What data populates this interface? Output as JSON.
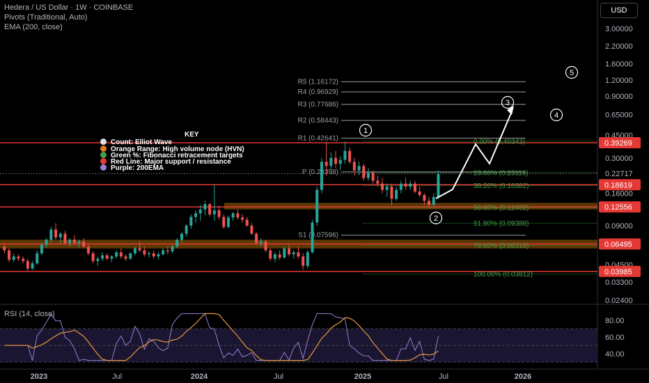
{
  "header": {
    "symbol": "Hedera / US Dollar · 1W · COINBASE",
    "indicator1": "Pivots (Traditional, Auto)",
    "indicator2": "EMA (200, close)"
  },
  "currency_button": "USD",
  "key": {
    "title": "KEY",
    "items": [
      {
        "label": "Count: Elliot Wave",
        "color": "#e0e0e0"
      },
      {
        "label": "Orange Range: High volume node (HVN)",
        "color": "#e07a1f"
      },
      {
        "label": "Green %: Fibonacci retracement targets",
        "color": "#43a047"
      },
      {
        "label": "Red Line: Major support / resistance",
        "color": "#e53935"
      },
      {
        "label": "Purple: 200EMA",
        "color": "#9c7fd4"
      }
    ]
  },
  "rsi_label": "RSI (14, close)",
  "colors": {
    "up": "#26a69a",
    "down": "#ef5350",
    "red_line": "#e53935",
    "hvn": "#7a4a06",
    "fib": "#43a047",
    "pivot": "#9e9e9e",
    "ema": "#9c7fd4",
    "rsi": "#9c7fd4",
    "rsi_ma": "#e89a3c"
  },
  "chart_data": {
    "type": "candlestick",
    "y_scale": "log",
    "price_axis_ticks": [
      "3.00000",
      "2.20000",
      "1.60000",
      "1.20000",
      "0.90000",
      "0.65000",
      "0.45000",
      "0.30000",
      "0.22717",
      "0.16000",
      "0.09000",
      "0.04500",
      "0.03300",
      "0.02400"
    ],
    "price_tags": [
      {
        "value": "0.39269",
        "color": "#e53935"
      },
      {
        "value": "0.18619",
        "color": "#e53935"
      },
      {
        "value": "0.12556",
        "color": "#e53935"
      },
      {
        "value": "0.06495",
        "color": "#e53935"
      },
      {
        "value": "0.03985",
        "color": "#e53935"
      }
    ],
    "current_price": "0.22717",
    "x_axis_labels": [
      "2023",
      "Jul",
      "2024",
      "Jul",
      "2025",
      "Jul",
      "2026"
    ],
    "red_lines": [
      0.39269,
      0.18619,
      0.12556,
      0.06495,
      0.03985
    ],
    "hvn_zones": [
      {
        "low": 0.06,
        "high": 0.07
      },
      {
        "low": 0.12,
        "high": 0.135
      }
    ],
    "pivots": [
      {
        "label": "R5 (1.16172)",
        "value": 1.16172
      },
      {
        "label": "R4 (0.96929)",
        "value": 0.96929
      },
      {
        "label": "R3 (0.77686)",
        "value": 0.77686
      },
      {
        "label": "R2 (0.58443)",
        "value": 0.58443
      },
      {
        "label": "R1 (0.42641)",
        "value": 0.42641
      },
      {
        "label": "P (0.23398)",
        "value": 0.23398
      },
      {
        "label": "S1 (0.07596)",
        "value": 0.07596
      }
    ],
    "fibonacci": [
      {
        "label": "0.00% (0.40343)",
        "value": 0.40343
      },
      {
        "label": "23.60% (0.23119)",
        "value": 0.23119
      },
      {
        "label": "38.20% (0.18382)",
        "value": 0.18382
      },
      {
        "label": "50.00% (0.12402)",
        "value": 0.12402
      },
      {
        "label": "61.80% (0.09388)",
        "value": 0.09388
      },
      {
        "label": "78.60% (0.06316)",
        "value": 0.06316
      },
      {
        "label": "100.00% (0.03812)",
        "value": 0.03812
      }
    ],
    "wave_labels": [
      "1",
      "2",
      "3",
      "4",
      "5"
    ],
    "candles": [
      {
        "o": 0.062,
        "h": 0.066,
        "l": 0.055,
        "c": 0.058
      },
      {
        "o": 0.058,
        "h": 0.06,
        "l": 0.047,
        "c": 0.049
      },
      {
        "o": 0.049,
        "h": 0.055,
        "l": 0.047,
        "c": 0.052
      },
      {
        "o": 0.052,
        "h": 0.054,
        "l": 0.048,
        "c": 0.05
      },
      {
        "o": 0.05,
        "h": 0.052,
        "l": 0.046,
        "c": 0.048
      },
      {
        "o": 0.048,
        "h": 0.05,
        "l": 0.04,
        "c": 0.042
      },
      {
        "o": 0.042,
        "h": 0.048,
        "l": 0.041,
        "c": 0.046
      },
      {
        "o": 0.046,
        "h": 0.058,
        "l": 0.045,
        "c": 0.055
      },
      {
        "o": 0.055,
        "h": 0.066,
        "l": 0.053,
        "c": 0.064
      },
      {
        "o": 0.064,
        "h": 0.072,
        "l": 0.061,
        "c": 0.07
      },
      {
        "o": 0.07,
        "h": 0.088,
        "l": 0.066,
        "c": 0.084
      },
      {
        "o": 0.084,
        "h": 0.094,
        "l": 0.07,
        "c": 0.073
      },
      {
        "o": 0.073,
        "h": 0.08,
        "l": 0.066,
        "c": 0.078
      },
      {
        "o": 0.078,
        "h": 0.082,
        "l": 0.064,
        "c": 0.066
      },
      {
        "o": 0.066,
        "h": 0.072,
        "l": 0.062,
        "c": 0.07
      },
      {
        "o": 0.07,
        "h": 0.076,
        "l": 0.064,
        "c": 0.066
      },
      {
        "o": 0.066,
        "h": 0.07,
        "l": 0.061,
        "c": 0.068
      },
      {
        "o": 0.068,
        "h": 0.072,
        "l": 0.06,
        "c": 0.062
      },
      {
        "o": 0.062,
        "h": 0.064,
        "l": 0.053,
        "c": 0.055
      },
      {
        "o": 0.055,
        "h": 0.057,
        "l": 0.046,
        "c": 0.048
      },
      {
        "o": 0.048,
        "h": 0.052,
        "l": 0.044,
        "c": 0.05
      },
      {
        "o": 0.05,
        "h": 0.056,
        "l": 0.048,
        "c": 0.053
      },
      {
        "o": 0.053,
        "h": 0.055,
        "l": 0.049,
        "c": 0.05
      },
      {
        "o": 0.05,
        "h": 0.053,
        "l": 0.047,
        "c": 0.052
      },
      {
        "o": 0.052,
        "h": 0.058,
        "l": 0.05,
        "c": 0.056
      },
      {
        "o": 0.056,
        "h": 0.06,
        "l": 0.05,
        "c": 0.052
      },
      {
        "o": 0.052,
        "h": 0.054,
        "l": 0.048,
        "c": 0.05
      },
      {
        "o": 0.05,
        "h": 0.056,
        "l": 0.049,
        "c": 0.055
      },
      {
        "o": 0.055,
        "h": 0.062,
        "l": 0.053,
        "c": 0.06
      },
      {
        "o": 0.06,
        "h": 0.068,
        "l": 0.056,
        "c": 0.058
      },
      {
        "o": 0.058,
        "h": 0.062,
        "l": 0.052,
        "c": 0.054
      },
      {
        "o": 0.054,
        "h": 0.057,
        "l": 0.051,
        "c": 0.055
      },
      {
        "o": 0.055,
        "h": 0.058,
        "l": 0.05,
        "c": 0.052
      },
      {
        "o": 0.052,
        "h": 0.056,
        "l": 0.049,
        "c": 0.054
      },
      {
        "o": 0.054,
        "h": 0.06,
        "l": 0.053,
        "c": 0.058
      },
      {
        "o": 0.058,
        "h": 0.062,
        "l": 0.054,
        "c": 0.057
      },
      {
        "o": 0.057,
        "h": 0.064,
        "l": 0.055,
        "c": 0.062
      },
      {
        "o": 0.062,
        "h": 0.072,
        "l": 0.06,
        "c": 0.07
      },
      {
        "o": 0.07,
        "h": 0.08,
        "l": 0.067,
        "c": 0.078
      },
      {
        "o": 0.078,
        "h": 0.092,
        "l": 0.074,
        "c": 0.09
      },
      {
        "o": 0.09,
        "h": 0.11,
        "l": 0.085,
        "c": 0.105
      },
      {
        "o": 0.105,
        "h": 0.118,
        "l": 0.095,
        "c": 0.112
      },
      {
        "o": 0.112,
        "h": 0.13,
        "l": 0.098,
        "c": 0.12
      },
      {
        "o": 0.12,
        "h": 0.14,
        "l": 0.108,
        "c": 0.132
      },
      {
        "o": 0.132,
        "h": 0.134,
        "l": 0.106,
        "c": 0.11
      },
      {
        "o": 0.11,
        "h": 0.185,
        "l": 0.098,
        "c": 0.118
      },
      {
        "o": 0.118,
        "h": 0.128,
        "l": 0.1,
        "c": 0.105
      },
      {
        "o": 0.105,
        "h": 0.11,
        "l": 0.085,
        "c": 0.088
      },
      {
        "o": 0.088,
        "h": 0.108,
        "l": 0.086,
        "c": 0.104
      },
      {
        "o": 0.104,
        "h": 0.115,
        "l": 0.098,
        "c": 0.112
      },
      {
        "o": 0.112,
        "h": 0.12,
        "l": 0.1,
        "c": 0.104
      },
      {
        "o": 0.104,
        "h": 0.11,
        "l": 0.095,
        "c": 0.1
      },
      {
        "o": 0.1,
        "h": 0.105,
        "l": 0.088,
        "c": 0.09
      },
      {
        "o": 0.09,
        "h": 0.094,
        "l": 0.076,
        "c": 0.078
      },
      {
        "o": 0.078,
        "h": 0.08,
        "l": 0.064,
        "c": 0.066
      },
      {
        "o": 0.066,
        "h": 0.072,
        "l": 0.062,
        "c": 0.068
      },
      {
        "o": 0.068,
        "h": 0.07,
        "l": 0.056,
        "c": 0.058
      },
      {
        "o": 0.058,
        "h": 0.06,
        "l": 0.048,
        "c": 0.05
      },
      {
        "o": 0.05,
        "h": 0.056,
        "l": 0.047,
        "c": 0.054
      },
      {
        "o": 0.054,
        "h": 0.058,
        "l": 0.049,
        "c": 0.051
      },
      {
        "o": 0.051,
        "h": 0.062,
        "l": 0.05,
        "c": 0.06
      },
      {
        "o": 0.06,
        "h": 0.064,
        "l": 0.052,
        "c": 0.054
      },
      {
        "o": 0.054,
        "h": 0.058,
        "l": 0.05,
        "c": 0.056
      },
      {
        "o": 0.056,
        "h": 0.062,
        "l": 0.05,
        "c": 0.052
      },
      {
        "o": 0.052,
        "h": 0.055,
        "l": 0.041,
        "c": 0.044
      },
      {
        "o": 0.044,
        "h": 0.058,
        "l": 0.042,
        "c": 0.056
      },
      {
        "o": 0.056,
        "h": 0.1,
        "l": 0.055,
        "c": 0.095
      },
      {
        "o": 0.095,
        "h": 0.18,
        "l": 0.09,
        "c": 0.17
      },
      {
        "o": 0.17,
        "h": 0.3,
        "l": 0.16,
        "c": 0.28
      },
      {
        "o": 0.28,
        "h": 0.4,
        "l": 0.22,
        "c": 0.26
      },
      {
        "o": 0.26,
        "h": 0.33,
        "l": 0.24,
        "c": 0.3
      },
      {
        "o": 0.3,
        "h": 0.34,
        "l": 0.25,
        "c": 0.27
      },
      {
        "o": 0.27,
        "h": 0.31,
        "l": 0.24,
        "c": 0.29
      },
      {
        "o": 0.29,
        "h": 0.4,
        "l": 0.27,
        "c": 0.34
      },
      {
        "o": 0.34,
        "h": 0.36,
        "l": 0.27,
        "c": 0.28
      },
      {
        "o": 0.28,
        "h": 0.3,
        "l": 0.22,
        "c": 0.24
      },
      {
        "o": 0.24,
        "h": 0.28,
        "l": 0.22,
        "c": 0.26
      },
      {
        "o": 0.26,
        "h": 0.27,
        "l": 0.2,
        "c": 0.21
      },
      {
        "o": 0.21,
        "h": 0.25,
        "l": 0.2,
        "c": 0.23
      },
      {
        "o": 0.23,
        "h": 0.24,
        "l": 0.19,
        "c": 0.2
      },
      {
        "o": 0.2,
        "h": 0.22,
        "l": 0.18,
        "c": 0.19
      },
      {
        "o": 0.19,
        "h": 0.21,
        "l": 0.16,
        "c": 0.17
      },
      {
        "o": 0.17,
        "h": 0.19,
        "l": 0.15,
        "c": 0.18
      },
      {
        "o": 0.18,
        "h": 0.19,
        "l": 0.13,
        "c": 0.145
      },
      {
        "o": 0.145,
        "h": 0.18,
        "l": 0.14,
        "c": 0.17
      },
      {
        "o": 0.17,
        "h": 0.2,
        "l": 0.16,
        "c": 0.19
      },
      {
        "o": 0.19,
        "h": 0.21,
        "l": 0.17,
        "c": 0.18
      },
      {
        "o": 0.18,
        "h": 0.2,
        "l": 0.17,
        "c": 0.19
      },
      {
        "o": 0.19,
        "h": 0.2,
        "l": 0.16,
        "c": 0.165
      },
      {
        "o": 0.165,
        "h": 0.18,
        "l": 0.15,
        "c": 0.155
      },
      {
        "o": 0.155,
        "h": 0.16,
        "l": 0.13,
        "c": 0.14
      },
      {
        "o": 0.14,
        "h": 0.15,
        "l": 0.125,
        "c": 0.13
      },
      {
        "o": 0.13,
        "h": 0.16,
        "l": 0.128,
        "c": 0.15
      },
      {
        "o": 0.15,
        "h": 0.24,
        "l": 0.145,
        "c": 0.225
      }
    ],
    "ema_200": [
      0.1,
      0.1,
      0.1,
      0.1
    ],
    "rsi": {
      "ticks": [
        "80.00",
        "60.00",
        "40.00"
      ],
      "levels": [
        70,
        50,
        30
      ]
    }
  }
}
